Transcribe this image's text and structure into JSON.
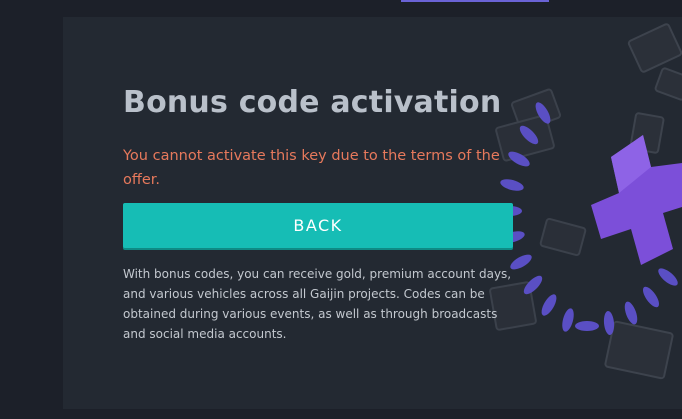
{
  "colors": {
    "page_background": "#1c2029",
    "panel_background": "#232932",
    "title": "#b9c0ca",
    "error": "#e7795c",
    "button": "#16bdb5",
    "button_text": "#ffffff",
    "body_text": "#c3c8cf",
    "accent": "#6a63d6"
  },
  "dialog": {
    "title": "Bonus code activation",
    "error_message": "You cannot activate this key due to the terms of the offer.",
    "back_button_label": "BACK",
    "info_text": "With bonus codes, you can receive gold, premium account days, and various vehicles across all Gaijin projects. Codes can be obtained during various events, as well as through broadcasts and social media accounts."
  },
  "decoration": {
    "icon": "bonus-plus-icon"
  }
}
